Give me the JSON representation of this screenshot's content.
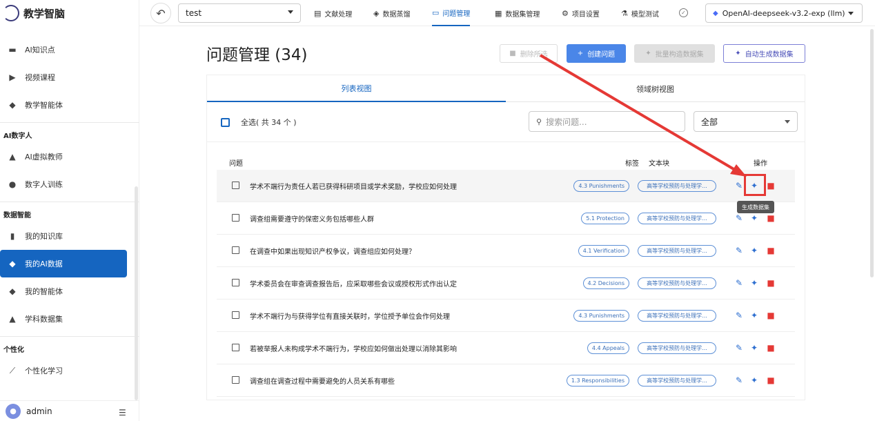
{
  "app": {
    "name": "教学智脑"
  },
  "sidebar": {
    "items_top": [
      {
        "label": "AI知识点",
        "icon": "clapperboard-icon"
      },
      {
        "label": "视频课程",
        "icon": "video-icon"
      },
      {
        "label": "教学智能体",
        "icon": "cube-icon"
      }
    ],
    "section_ai": "AI数字人",
    "items_ai": [
      {
        "label": "AI虚拟教师",
        "icon": "graduation-cap-icon"
      },
      {
        "label": "数字人训练",
        "icon": "person-icon"
      }
    ],
    "section_data": "数据智能",
    "items_data": [
      {
        "label": "我的知识库",
        "icon": "book-icon"
      },
      {
        "label": "我的AI数据",
        "icon": "data-cube-icon",
        "active": true
      },
      {
        "label": "我的智能体",
        "icon": "cube-icon"
      },
      {
        "label": "学科数据集",
        "icon": "graduation-cap-icon"
      }
    ],
    "section_personal": "个性化",
    "items_personal": [
      {
        "label": "个性化学习",
        "icon": "wand-icon"
      }
    ],
    "user": {
      "name": "admin"
    }
  },
  "topbar": {
    "project": "test",
    "tabs": [
      "文献处理",
      "数据蒸馏",
      "问题管理",
      "数据集管理",
      "项目设置",
      "模型测试"
    ],
    "active_tab": "问题管理",
    "model": "OpenAI-deepseek-v3.2-exp (llm)"
  },
  "main": {
    "title": "问题管理 (34)",
    "buttons": {
      "delete": "删除所选",
      "create": "创建问题",
      "batch": "批量构造数据集",
      "auto": "自动生成数据集"
    },
    "view_tabs": [
      "列表视图",
      "领域树视图"
    ],
    "active_view": "列表视图",
    "select_all": "全选( 共 34 个 )",
    "search_placeholder": "搜索问题...",
    "filter": "全部",
    "columns": {
      "question": "问题",
      "tag": "标签",
      "chunk": "文本块",
      "action": "操作"
    },
    "rows": [
      {
        "question": "学术不端行为责任人若已获得科研项目或学术奖励，学校应如何处理",
        "tag": "4.3 Punishments",
        "chunk": "高等学校预防与处理学..."
      },
      {
        "question": "调查组需要遵守的保密义务包括哪些人群",
        "tag": "5.1 Protection",
        "chunk": "高等学校预防与处理学..."
      },
      {
        "question": "在调查中如果出现知识产权争议，调查组应如何处理？",
        "tag": "4.1 Verification",
        "chunk": "高等学校预防与处理学..."
      },
      {
        "question": "学术委员会在审查调查报告后，应采取哪些会议或授权形式作出认定",
        "tag": "4.2 Decisions",
        "chunk": "高等学校预防与处理学..."
      },
      {
        "question": "学术不端行为与获得学位有直接关联时，学位授予单位会作何处理",
        "tag": "4.3 Punishments",
        "chunk": "高等学校预防与处理学..."
      },
      {
        "question": "若被举报人未构成学术不端行为，学校应如何做出处理以消除其影响",
        "tag": "4.4 Appeals",
        "chunk": "高等学校预防与处理学..."
      },
      {
        "question": "调查组在调查过程中需要避免的人员关系有哪些",
        "tag": "1.3 Responsibilities",
        "chunk": "高等学校预防与处理学..."
      }
    ],
    "tooltip": "生成数据集"
  },
  "colors": {
    "accent": "#1565c0",
    "annotation": "#e53935"
  }
}
